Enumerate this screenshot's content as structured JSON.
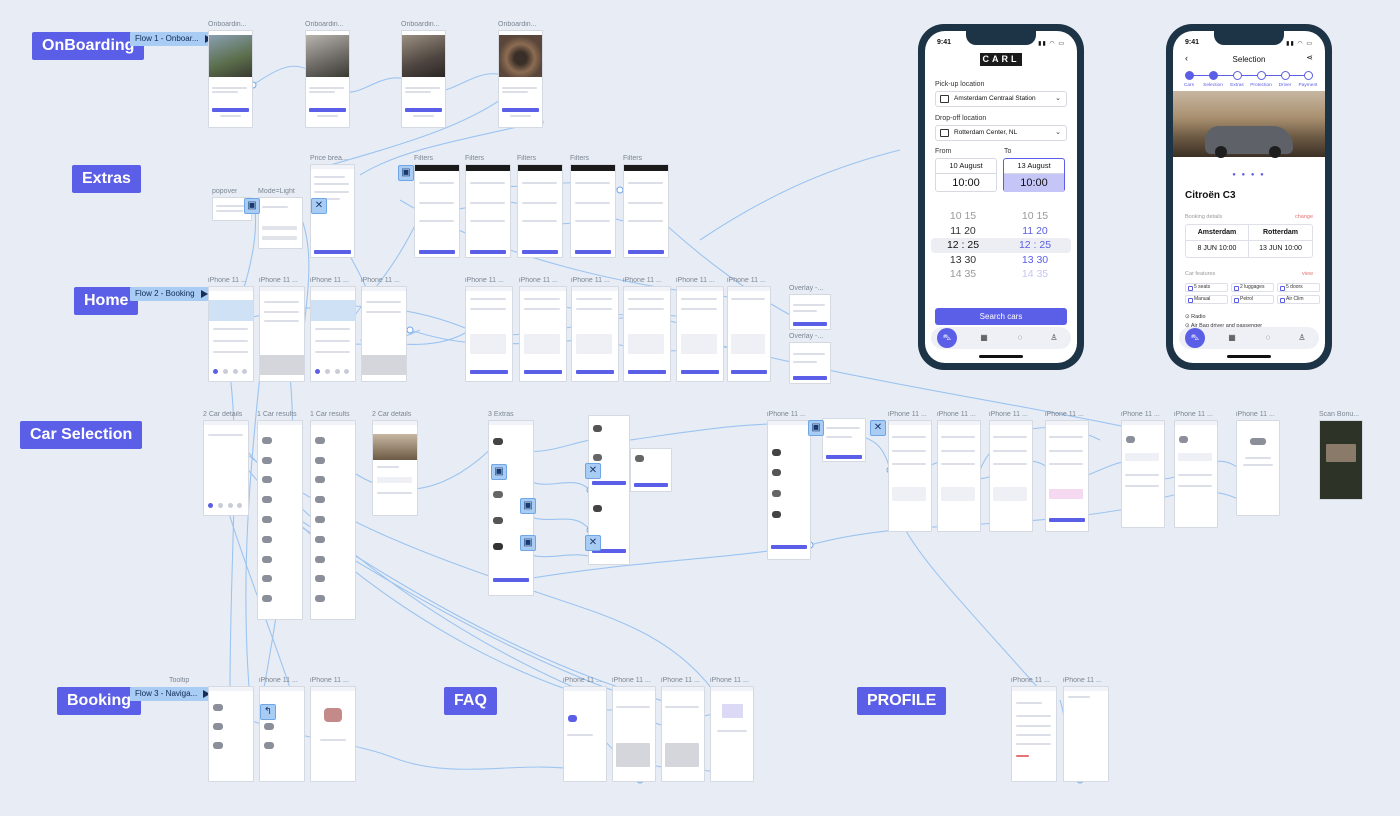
{
  "sections": {
    "onboarding": "OnBoarding",
    "extras": "Extras",
    "home": "Home",
    "car_selection": "Car Selection",
    "booking": "Booking",
    "faq": "FAQ",
    "profile": "PROFILE"
  },
  "flows": {
    "flow1": "Flow 1 - Onboar...",
    "flow2": "Flow 2 - Booking",
    "flow3": "Flow 3 - Naviga..."
  },
  "frame_labels": {
    "onb": "Onboardin...",
    "popover": "popover",
    "mode_light": "Mode=Light",
    "price": "Price brea...",
    "filters": "Filters",
    "iphone": "iPhone 11 ...",
    "overlay": "Overlay -...",
    "car_details_2": "2 Car details",
    "car_results_1": "1 Car results",
    "extras_3": "3 Extras",
    "scan": "Scan Bonu...",
    "tooltip": "Tooltip"
  },
  "home_phone": {
    "time": "9:41",
    "logo": "CARL",
    "pickup_label": "Pick-up location",
    "pickup_value": "Amsterdam Centraal Station",
    "dropoff_label": "Drop-off location",
    "dropoff_value": "Rotterdam Center, NL",
    "from_label": "From",
    "to_label": "To",
    "from_date": "10 August",
    "from_time": "10:00",
    "to_date": "13 August",
    "to_time": "10:00",
    "picker_left": [
      "10  15",
      "11  20",
      "12 : 25",
      "13  30",
      "14  35"
    ],
    "picker_right": [
      "10  15",
      "11  20",
      "12 : 25",
      "13  30",
      "14  35"
    ],
    "search_button": "Search cars"
  },
  "selection_phone": {
    "time": "9:41",
    "title": "Selection",
    "steps": [
      "Cars",
      "Selection",
      "Extras",
      "Protection",
      "Driver",
      "Payment"
    ],
    "car_name": "Citroën C3",
    "booking_details": "Booking details",
    "change": "change",
    "from_city": "Amsterdam",
    "to_city": "Rotterdam",
    "from_date": "8 JUN 10:00",
    "to_date": "13 JUN 10:00",
    "car_features": "Car features",
    "view": "view",
    "features": [
      "5 seats",
      "2 luggages",
      "5 doors",
      "Manual",
      "Petrol",
      "Air Clim"
    ],
    "extras": [
      "Radio",
      "Air Bag driver and passenger"
    ]
  },
  "colors": {
    "accent": "#5b5ee6",
    "connector": "#a8ccf3",
    "canvas_bg": "#e8edf5"
  }
}
